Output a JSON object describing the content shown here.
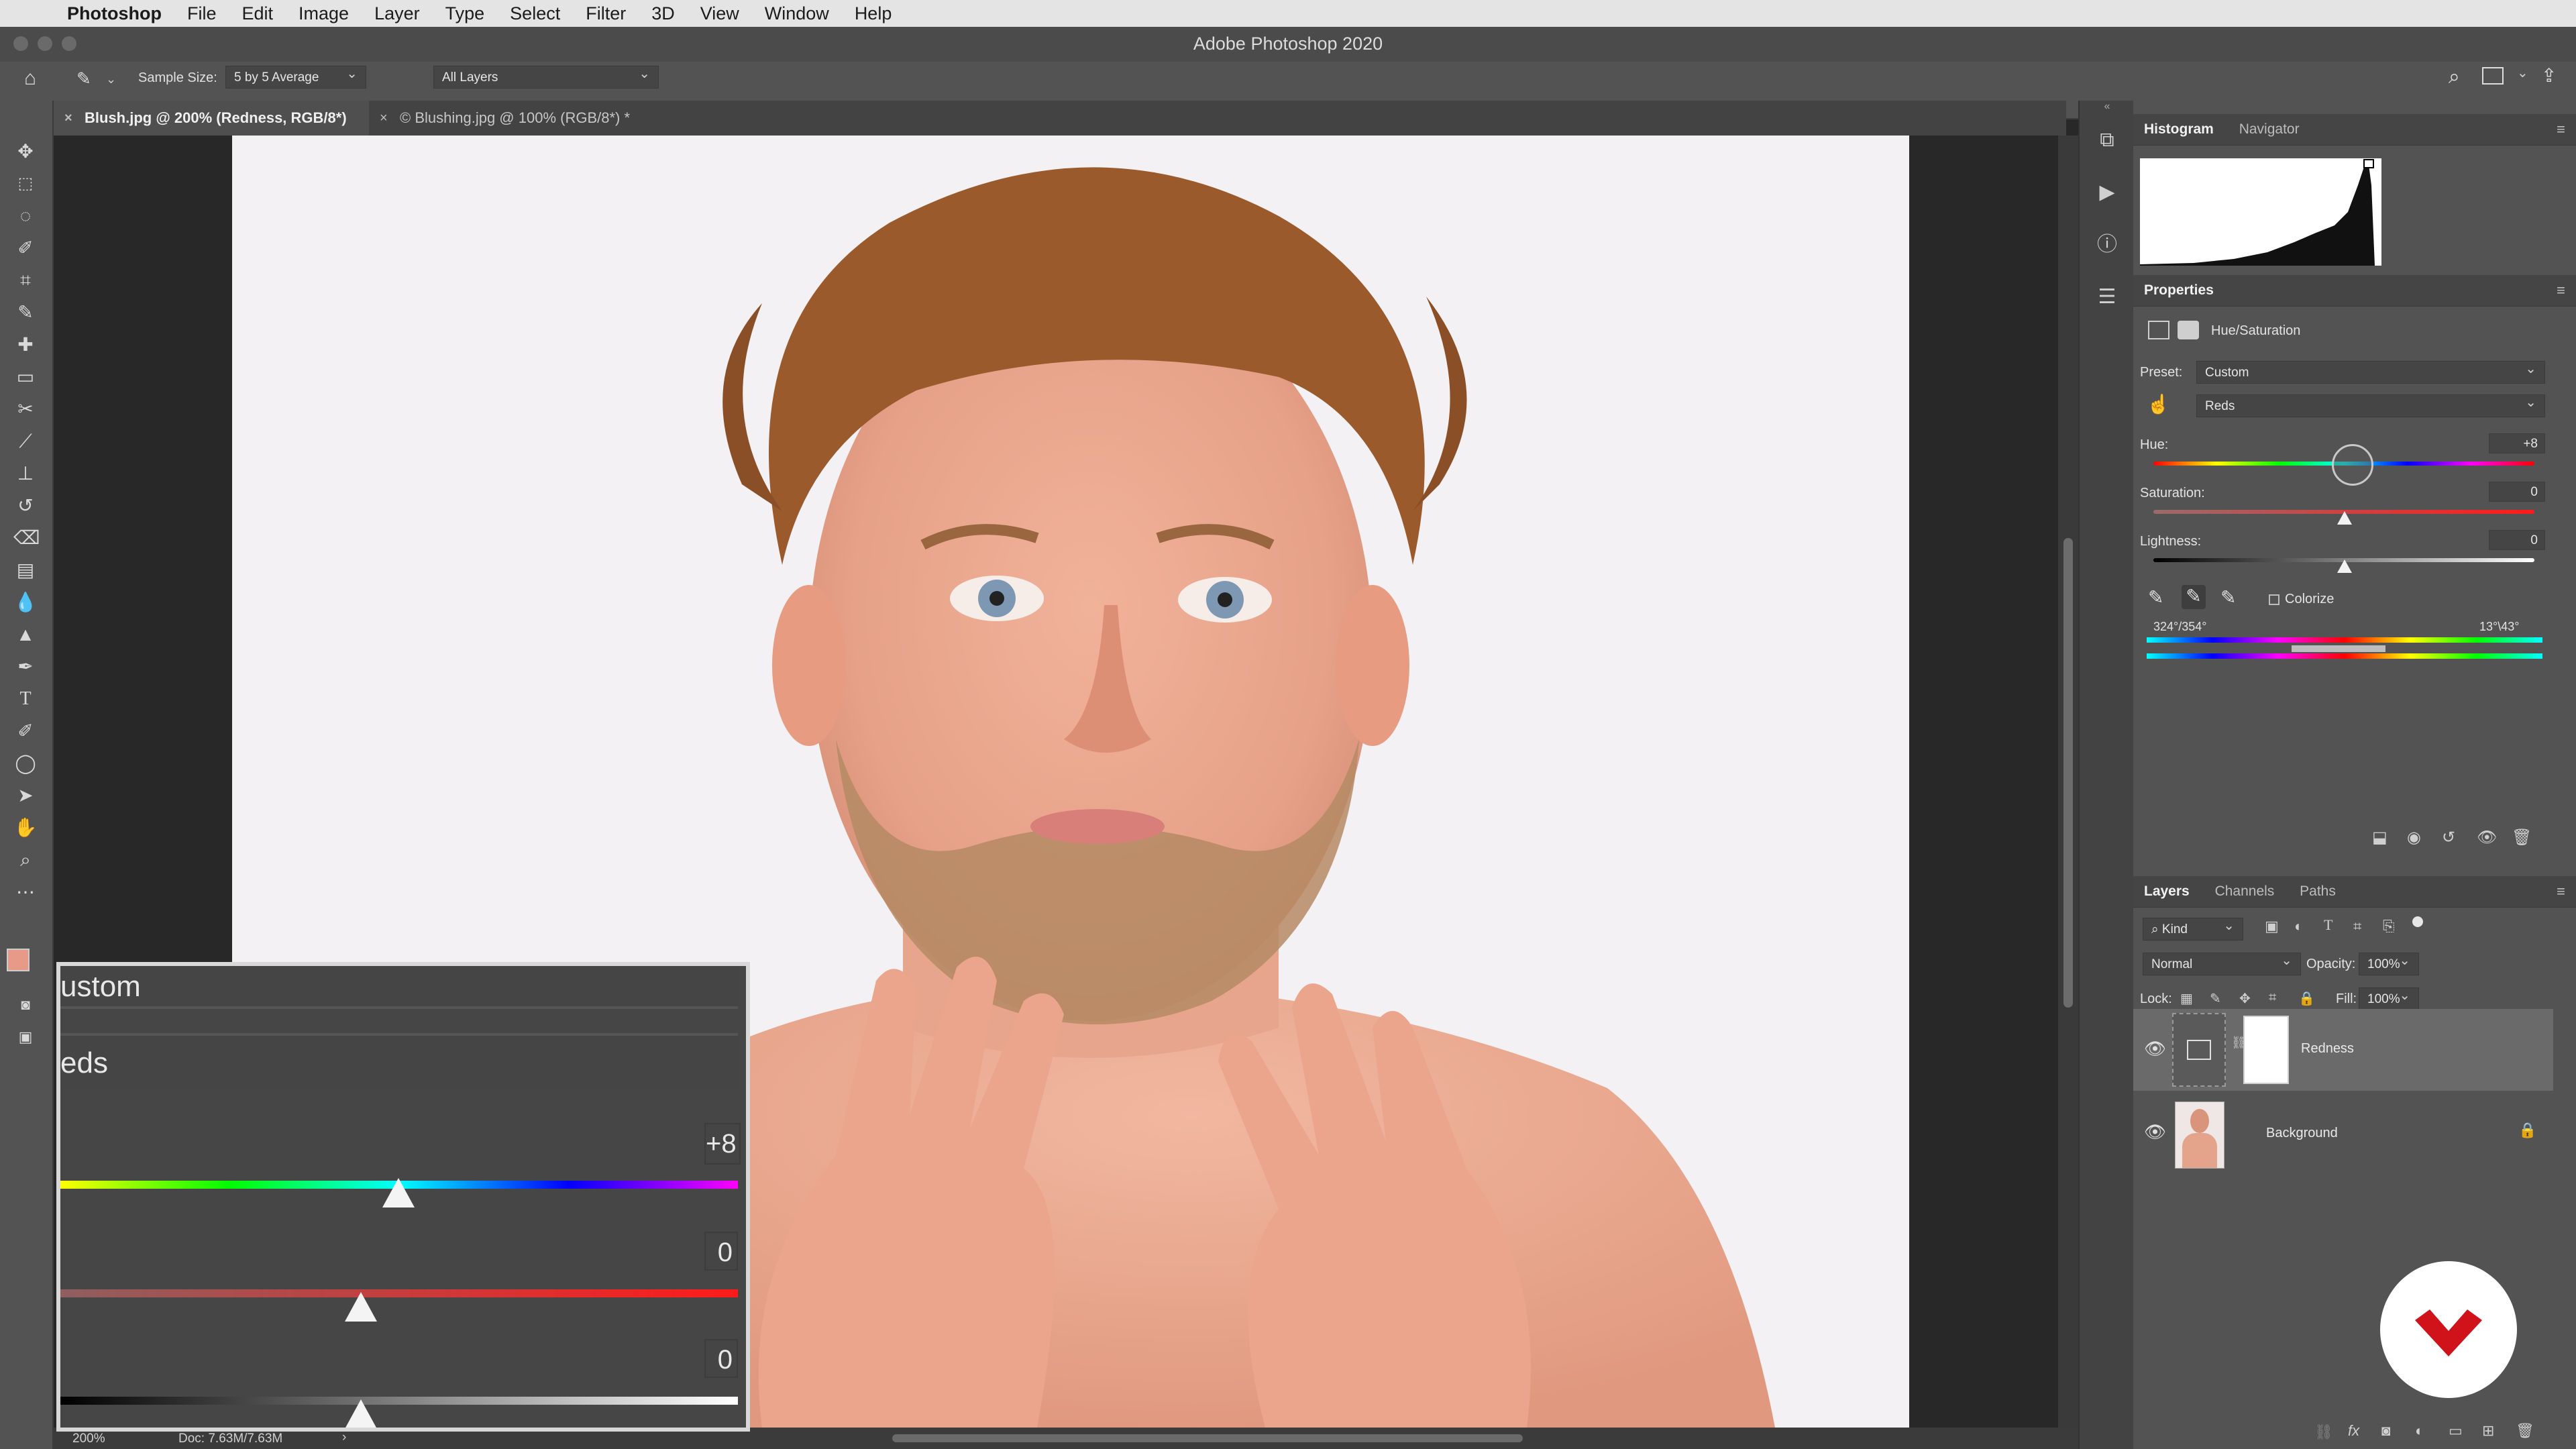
{
  "menubar": {
    "app_name": "Photoshop",
    "items": [
      "File",
      "Edit",
      "Image",
      "Layer",
      "Type",
      "Select",
      "Filter",
      "3D",
      "View",
      "Window",
      "Help"
    ]
  },
  "window": {
    "title": "Adobe Photoshop 2020"
  },
  "options_bar": {
    "sample_size_label": "Sample Size:",
    "sample_size_value": "5 by 5 Average",
    "sample_layers_value": "All Layers"
  },
  "tabs": [
    {
      "label": "Blush.jpg @ 200% (Redness, RGB/8*) *",
      "active": true
    },
    {
      "label": "© Blushing.jpg @ 100% (RGB/8*) *",
      "active": false
    }
  ],
  "status": {
    "zoom": "200%",
    "doc": "Doc: 7.63M/7.63M"
  },
  "histogram_panel": {
    "tabs": [
      "Histogram",
      "Navigator"
    ]
  },
  "properties": {
    "title": "Properties",
    "adjustment": "Hue/Saturation",
    "preset_label": "Preset:",
    "preset_value": "Custom",
    "channel_value": "Reds",
    "hue_label": "Hue:",
    "hue_value": "+8",
    "saturation_label": "Saturation:",
    "saturation_value": "0",
    "lightness_label": "Lightness:",
    "lightness_value": "0",
    "colorize_label": "Colorize",
    "range_left": "324°/354°",
    "range_right": "13°\\43°"
  },
  "layers_panel": {
    "tabs": [
      "Layers",
      "Channels",
      "Paths"
    ],
    "kind_label": "Kind",
    "blend_mode": "Normal",
    "opacity_label": "Opacity:",
    "opacity_value": "100%",
    "lock_label": "Lock:",
    "fill_label": "Fill:",
    "fill_value": "100%",
    "layers": [
      {
        "name": "Redness",
        "selected": true
      },
      {
        "name": "Background",
        "selected": false
      }
    ]
  },
  "zoom_callout": {
    "preset_fragment": "ustom",
    "channel_fragment": "eds",
    "hue_fragment": "+8",
    "saturation_value": "0",
    "lightness_value": "0"
  },
  "colors": {
    "accent_logo": "#d0121b",
    "panel_bg": "#535353",
    "canvas_bg": "#282828"
  }
}
